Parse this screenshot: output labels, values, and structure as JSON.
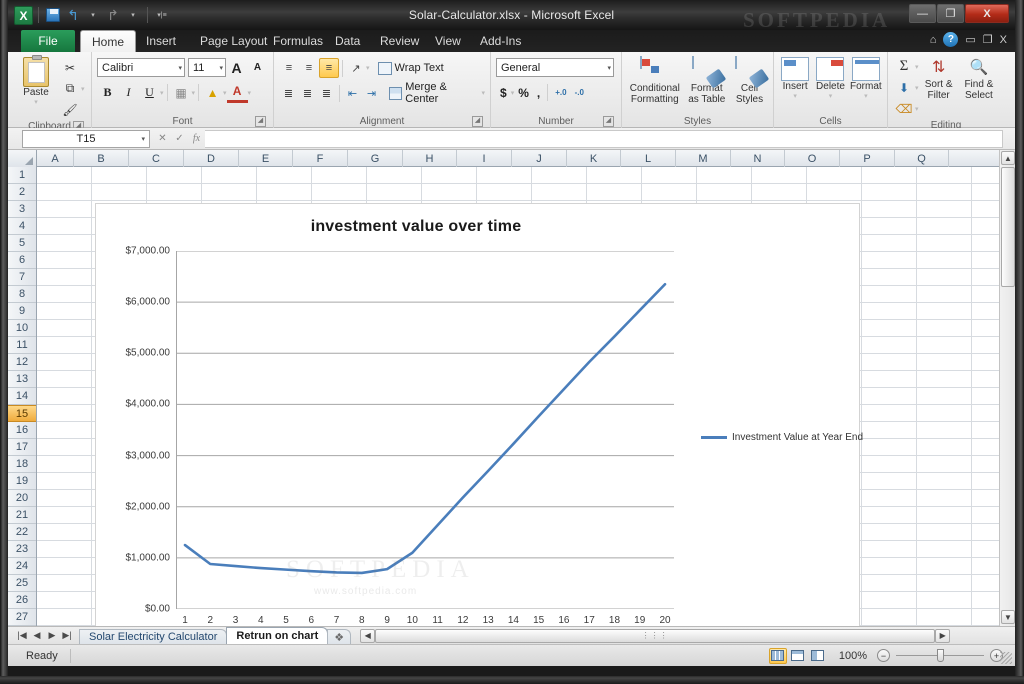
{
  "window": {
    "title": "Solar-Calculator.xlsx  -  Microsoft Excel",
    "watermark": "SOFTPEDIA",
    "minimize_label": "—",
    "maximize_label": "❐",
    "close_label": "X"
  },
  "quick_access": {
    "logo_label": "X",
    "save_label": "Save",
    "undo_label": "↰",
    "undo_caret": "▾",
    "redo_label": "↱",
    "redo_caret": "▾",
    "customize_label": "▾|≡"
  },
  "help_controls": {
    "minimize_ribbon": "⌂",
    "help": "?",
    "restore_down": "▭",
    "window_restore": "❐",
    "close": "X"
  },
  "ribbon": {
    "tabs": [
      {
        "label": "File",
        "active": false
      },
      {
        "label": "Home",
        "active": true
      },
      {
        "label": "Insert",
        "active": false
      },
      {
        "label": "Page Layout",
        "active": false
      },
      {
        "label": "Formulas",
        "active": false
      },
      {
        "label": "Data",
        "active": false
      },
      {
        "label": "Review",
        "active": false
      },
      {
        "label": "View",
        "active": false
      },
      {
        "label": "Add-Ins",
        "active": false
      }
    ],
    "groups": {
      "clipboard": {
        "label": "Clipboard",
        "paste": "Paste",
        "paste_caret": "▾",
        "cut": "✂",
        "copy": "⧉",
        "copy_caret": "▾",
        "format_painter": "🖌",
        "dialog_launcher": "◢"
      },
      "font": {
        "label": "Font",
        "font_name": "Calibri",
        "font_size": "11",
        "grow_font": "A",
        "shrink_font": "A",
        "bold": "B",
        "italic": "I",
        "underline": "U",
        "borders": "▦",
        "fill_color": "▲",
        "font_color": "A",
        "caret": "▾",
        "dialog_launcher": "◢"
      },
      "alignment": {
        "label": "Alignment",
        "align_top": "≡",
        "align_middle": "≡",
        "align_bottom": "≡",
        "orientation": "↗",
        "align_left": "≣",
        "align_center": "≣",
        "align_right": "≣",
        "decrease_indent": "⇤",
        "increase_indent": "⇥",
        "wrap_text": "Wrap Text",
        "merge_center": "Merge & Center",
        "caret": "▾",
        "dialog_launcher": "◢"
      },
      "number": {
        "label": "Number",
        "format": "General",
        "accounting": "$",
        "percent": "%",
        "comma": ",",
        "increase_decimal": "+.0",
        "decrease_decimal": "-.0",
        "caret": "▾",
        "dialog_launcher": "◢"
      },
      "styles": {
        "label": "Styles",
        "conditional_formatting": "Conditional\nFormatting",
        "conditional_formatting_l1": "Conditional",
        "conditional_formatting_l2": "Formatting",
        "format_as_table_l1": "Format",
        "format_as_table_l2": "as Table",
        "cell_styles_l1": "Cell",
        "cell_styles_l2": "Styles",
        "caret": "▾"
      },
      "cells": {
        "label": "Cells",
        "insert": "Insert",
        "delete": "Delete",
        "format": "Format",
        "caret": "▾"
      },
      "editing": {
        "label": "Editing",
        "autosum": "Σ",
        "fill": "⬇",
        "clear": "⌫",
        "sort_filter_l1": "Sort &",
        "sort_filter_l2": "Filter",
        "find_select_l1": "Find &",
        "find_select_l2": "Select",
        "caret": "▾"
      }
    }
  },
  "formula_bar": {
    "name_box_value": "T15",
    "name_box_caret": "▾",
    "cancel": "✕",
    "enter": "✓",
    "insert_function": "fx",
    "formula_value": ""
  },
  "grid": {
    "columns": [
      "A",
      "B",
      "C",
      "D",
      "E",
      "F",
      "G",
      "H",
      "I",
      "J",
      "K",
      "L",
      "M",
      "N",
      "O",
      "P",
      "Q"
    ],
    "rows": [
      1,
      2,
      3,
      4,
      5,
      6,
      7,
      8,
      9,
      10,
      11,
      12,
      13,
      14,
      15,
      16,
      17,
      18,
      19,
      20,
      21,
      22,
      23,
      24,
      25,
      26,
      27
    ],
    "selected_row": 15,
    "select_all_label": "◢"
  },
  "chart_data": {
    "type": "line",
    "title": "investment value over time",
    "xlabel": "",
    "ylabel": "",
    "grid": true,
    "legend_position": "right",
    "x": [
      1,
      2,
      3,
      4,
      5,
      6,
      7,
      8,
      9,
      10,
      11,
      12,
      13,
      14,
      15,
      16,
      17,
      18,
      19,
      20
    ],
    "categories": [
      "1",
      "2",
      "3",
      "4",
      "5",
      "6",
      "7",
      "8",
      "9",
      "10",
      "11",
      "12",
      "13",
      "14",
      "15",
      "16",
      "17",
      "18",
      "19",
      "20"
    ],
    "ytick_labels": [
      "$0.00",
      "$1,000.00",
      "$2,000.00",
      "$3,000.00",
      "$4,000.00",
      "$5,000.00",
      "$6,000.00",
      "$7,000.00"
    ],
    "ytick_values": [
      0,
      1000,
      2000,
      3000,
      4000,
      5000,
      6000,
      7000
    ],
    "ylim": [
      0,
      7000
    ],
    "xlim": [
      1,
      20
    ],
    "series": [
      {
        "name": "Investment Value at Year End",
        "color": "#4a7ebb",
        "values": [
          1250,
          880,
          840,
          800,
          770,
          740,
          715,
          705,
          780,
          1100,
          1640,
          2180,
          2700,
          3230,
          3770,
          4300,
          4830,
          5330,
          5840,
          6350
        ]
      }
    ]
  },
  "sheet_tabs": {
    "first": "|◀",
    "prev": "◀",
    "next": "▶",
    "last": "▶|",
    "tabs": [
      {
        "label": "Solar Electricity Calculator",
        "active": false
      },
      {
        "label": "Retrun on chart",
        "active": true
      }
    ],
    "insert_sheet": "❖"
  },
  "scrollbars": {
    "h_left_arrow": "◀",
    "h_right_arrow": "▶",
    "h_thumb_grip": "⋮⋮⋮",
    "v_up_arrow": "▲",
    "v_down_arrow": "▼"
  },
  "status_bar": {
    "status": "Ready",
    "view_normal": "Normal",
    "view_page_layout": "Page Layout",
    "view_page_break": "Page Break Preview",
    "zoom_level": "100%",
    "zoom_out": "−",
    "zoom_in": "+"
  },
  "chart_watermark": {
    "line1": "SOFTPEDIA",
    "line2": "www.softpedia.com"
  }
}
